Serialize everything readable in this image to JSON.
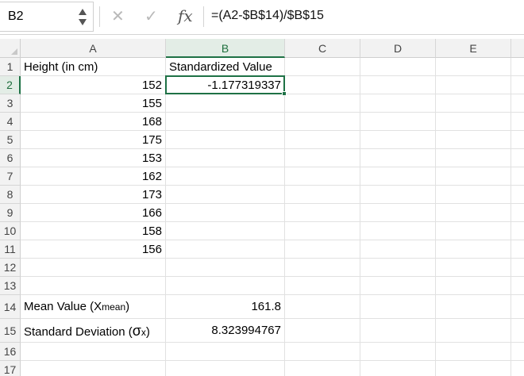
{
  "formula_bar": {
    "name_box": "B2",
    "fx_label": "fx",
    "cancel_symbol": "✕",
    "confirm_symbol": "✓",
    "formula": "=(A2-$B$14)/$B$15"
  },
  "columns": [
    "A",
    "B",
    "C",
    "D",
    "E"
  ],
  "rows": [
    "1",
    "2",
    "3",
    "4",
    "5",
    "6",
    "7",
    "8",
    "9",
    "10",
    "11",
    "12",
    "13",
    "14",
    "15",
    "16",
    "17"
  ],
  "cells": {
    "A1": "Height (in cm)",
    "B1": "Standardized Value",
    "A2": "152",
    "B2": "-1.177319337",
    "A3": "155",
    "A4": "168",
    "A5": "175",
    "A6": "153",
    "A7": "162",
    "A8": "173",
    "A9": "166",
    "A10": "158",
    "A11": "156",
    "A14": "Mean Value (X",
    "A14_sub": "mean",
    "A14_end": ")",
    "B14": "161.8",
    "A15": "Standard Deviation (",
    "A15_sigma": "σ",
    "A15_sub": "x",
    "A15_end": ")",
    "B15": "8.323994767"
  },
  "selection": {
    "cell": "B2",
    "accent": "#1e7145"
  }
}
